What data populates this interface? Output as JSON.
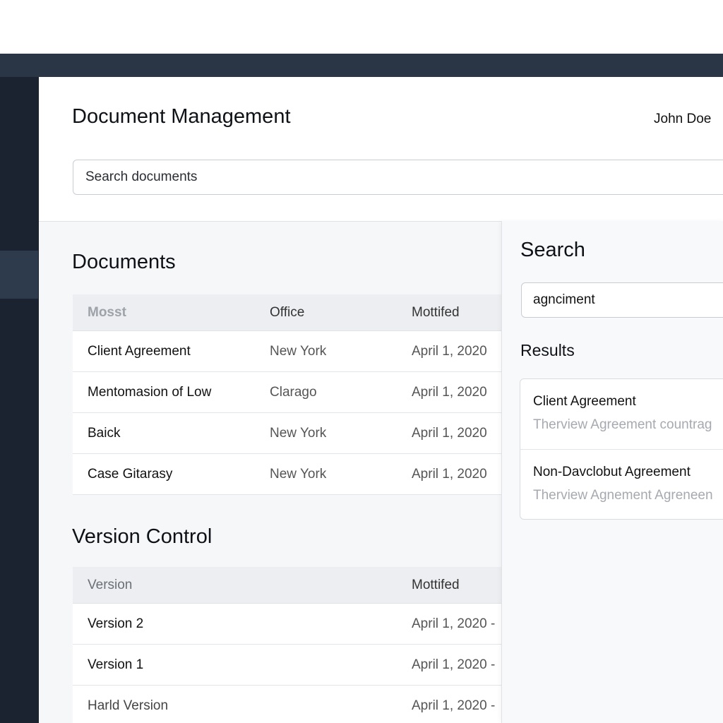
{
  "header": {
    "title": "Document Management",
    "user_name": "John Doe",
    "search_placeholder": "Search documents"
  },
  "documents": {
    "title": "Documents",
    "columns": [
      "Mosst",
      "Office",
      "Mottifed"
    ],
    "rows": [
      {
        "name": "Client Agreement",
        "office": "New York",
        "modified": "April 1, 2020"
      },
      {
        "name": "Mentomasion of Low",
        "office": "Clarago",
        "modified": "April 1, 2020"
      },
      {
        "name": "Baick",
        "office": "New York",
        "modified": "April 1, 2020"
      },
      {
        "name": "Case Gitarasy",
        "office": "New York",
        "modified": "April 1, 2020"
      }
    ]
  },
  "version_control": {
    "title": "Version Control",
    "columns": [
      "Version",
      "Mottifed"
    ],
    "rows": [
      {
        "version": "Version 2",
        "modified": "April 1, 2020 -"
      },
      {
        "version": "Version 1",
        "modified": "April 1, 2020 -"
      },
      {
        "version": "Harld Version",
        "modified": "April 1, 2020 -"
      }
    ]
  },
  "search_panel": {
    "title": "Search",
    "query": "agnciment",
    "results_title": "Results",
    "results": [
      {
        "title": "Client Agreement",
        "snippet": "Therview Agreement countrag"
      },
      {
        "title": "Non-Davclobut Agreement",
        "snippet": "Therview Agnement Agreneen"
      }
    ]
  },
  "colors": {
    "chrome_dark": "#1d2430",
    "titlebar": "#2a3646",
    "sidebar_active": "#2e3b4c",
    "table_header": "#eceef1",
    "muted_text": "#a6aab0"
  }
}
